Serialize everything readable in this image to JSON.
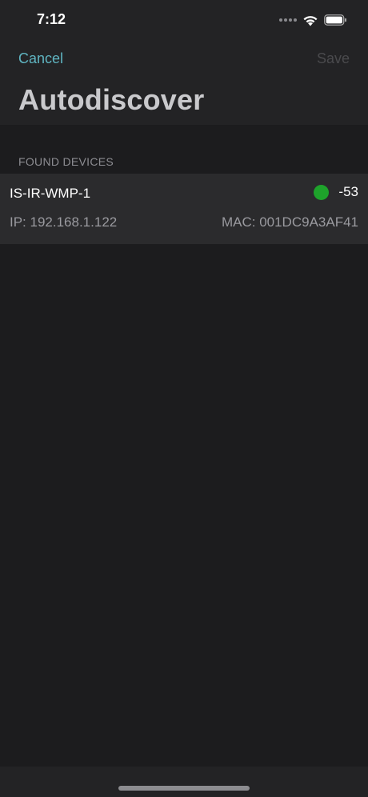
{
  "status_bar": {
    "time": "7:12",
    "icons": [
      "signal-dots-icon",
      "wifi-icon",
      "battery-icon"
    ]
  },
  "nav": {
    "cancel_label": "Cancel",
    "save_label": "Save"
  },
  "title": "Autodiscover",
  "section": {
    "header": "FOUND DEVICES"
  },
  "devices": [
    {
      "name": "IS-IR-WMP-1",
      "signal": "-53",
      "signal_color": "#1ea32b",
      "ip": "IP: 192.168.1.122",
      "mac": "MAC: 001DC9A3AF41"
    }
  ],
  "colors": {
    "accent": "#5fb4c1",
    "background": "#1c1c1e",
    "signal_good": "#1ea32b"
  }
}
